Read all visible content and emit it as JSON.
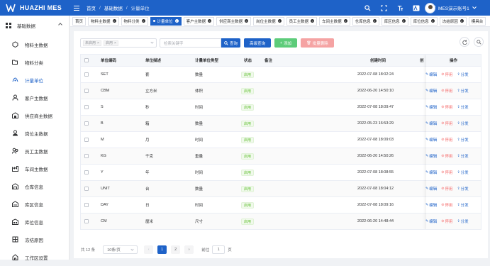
{
  "app": {
    "brand": "HUAZHI MES",
    "user_name": "MES演示账号1"
  },
  "breadcrumb": [
    "首页",
    "基础数据",
    "计量单位"
  ],
  "sidebar": {
    "group": "基础数据",
    "items": [
      {
        "label": "物料主数据",
        "icon": "box-icon"
      },
      {
        "label": "物料分类",
        "icon": "folder-icon"
      },
      {
        "label": "计量单位",
        "icon": "scale-icon",
        "active": true
      },
      {
        "label": "客户主数据",
        "icon": "customer-icon"
      },
      {
        "label": "供应商主数据",
        "icon": "supplier-icon"
      },
      {
        "label": "岗位主数据",
        "icon": "post-icon"
      },
      {
        "label": "员工主数据",
        "icon": "employee-icon"
      },
      {
        "label": "车间主数据",
        "icon": "workshop-icon"
      },
      {
        "label": "仓库信息",
        "icon": "warehouse-icon"
      },
      {
        "label": "库区信息",
        "icon": "zone-icon"
      },
      {
        "label": "库位信息",
        "icon": "location-icon"
      },
      {
        "label": "冻结原因",
        "icon": "freeze-icon"
      },
      {
        "label": "工作区设置",
        "icon": "workspace-icon"
      }
    ]
  },
  "tabs": [
    {
      "label": "首页"
    },
    {
      "label": "物料主数据"
    },
    {
      "label": "物料分类"
    },
    {
      "label": "计量单位",
      "active": true
    },
    {
      "label": "客户主数据"
    },
    {
      "label": "供应商主数据"
    },
    {
      "label": "岗位主数据"
    },
    {
      "label": "员工主数据"
    },
    {
      "label": "车间主数据"
    },
    {
      "label": "仓库信息"
    },
    {
      "label": "库区信息"
    },
    {
      "label": "库位信息"
    },
    {
      "label": "冻结原因"
    },
    {
      "label": "模具台"
    }
  ],
  "toolbar": {
    "filter_chips": [
      "未启用",
      "启用"
    ],
    "search_placeholder": "检索关键字",
    "search_button": "查询",
    "advanced_button": "高级查询",
    "add_button": "添加",
    "batch_delete_button": "批量删除"
  },
  "table": {
    "columns": [
      "单位编码",
      "单位描述",
      "计量单位类型",
      "状态",
      "备注",
      "创建时间",
      "创",
      "操作"
    ],
    "rows": [
      {
        "code": "SET",
        "desc": "套",
        "type": "数量",
        "status": "启用",
        "note": "",
        "created": "2022-07-08 18:02:24"
      },
      {
        "code": "CBM",
        "desc": "立方米",
        "type": "体积",
        "status": "启用",
        "note": "",
        "created": "2022-06-20 14:50:10"
      },
      {
        "code": "S",
        "desc": "秒",
        "type": "时间",
        "status": "启用",
        "note": "",
        "created": "2022-07-08 18:09:47"
      },
      {
        "code": "B",
        "desc": "箱",
        "type": "数量",
        "status": "启用",
        "note": "",
        "created": "2022-05-23 16:53:29"
      },
      {
        "code": "M",
        "desc": "月",
        "type": "时间",
        "status": "启用",
        "note": "",
        "created": "2022-07-08 18:09:03"
      },
      {
        "code": "KG",
        "desc": "千克",
        "type": "重量",
        "status": "启用",
        "note": "",
        "created": "2022-06-20 14:50:26"
      },
      {
        "code": "Y",
        "desc": "年",
        "type": "时间",
        "status": "启用",
        "note": "",
        "created": "2022-07-08 18:08:55"
      },
      {
        "code": "UNIT",
        "desc": "台",
        "type": "数量",
        "status": "启用",
        "note": "",
        "created": "2022-07-08 18:04:12"
      },
      {
        "code": "DAY",
        "desc": "日",
        "type": "时间",
        "status": "启用",
        "note": "",
        "created": "2022-07-08 18:09:16"
      },
      {
        "code": "CM",
        "desc": "厘米",
        "type": "尺寸",
        "status": "启用",
        "note": "",
        "created": "2022-06-20 14:48:44"
      }
    ],
    "actions": [
      "编辑",
      "停用",
      "分发"
    ]
  },
  "pager": {
    "total": "共 12 条",
    "page_size": "10条/页",
    "pages": [
      "1",
      "2"
    ],
    "current_page": "1",
    "goto_label": "前往",
    "goto_value": "1",
    "page_suffix": "页"
  },
  "colors": {
    "primary": "#1e62c8",
    "success": "#5dcc7a",
    "danger": "#f56c6c"
  }
}
